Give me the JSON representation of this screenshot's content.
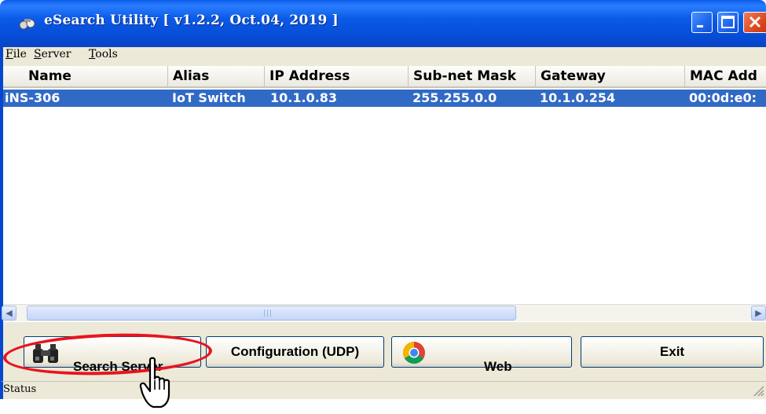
{
  "window": {
    "title": "eSearch Utility [ v1.2.2, Oct.04, 2019 ]",
    "icons": {
      "app": "binoculars-app-icon",
      "minimize": "minimize-icon",
      "maximize": "maximize-icon",
      "close": "close-icon"
    }
  },
  "menu": {
    "items": [
      {
        "accel": "F",
        "rest": "ile"
      },
      {
        "accel": "S",
        "rest": "erver"
      },
      {
        "accel": "T",
        "rest": "ools"
      }
    ]
  },
  "list": {
    "columns": [
      "Name",
      "Alias",
      "IP Address",
      "Sub-net Mask",
      "Gateway",
      "MAC Add"
    ],
    "rows": [
      {
        "name": "iNS-306",
        "alias": "IoT Switch",
        "ip": "10.1.0.83",
        "mask": "255.255.0.0",
        "gateway": "10.1.0.254",
        "mac": "00:0d:e0:"
      }
    ],
    "selected_color": "#316ac5"
  },
  "buttons": {
    "search": "Search Server",
    "config": "Configuration (UDP)",
    "web": "Web",
    "exit": "Exit"
  },
  "status": {
    "text": "Status"
  },
  "colors": {
    "titlebar": "#0a5ae6",
    "highlight": "#e8141e",
    "face": "#ece9d8"
  }
}
